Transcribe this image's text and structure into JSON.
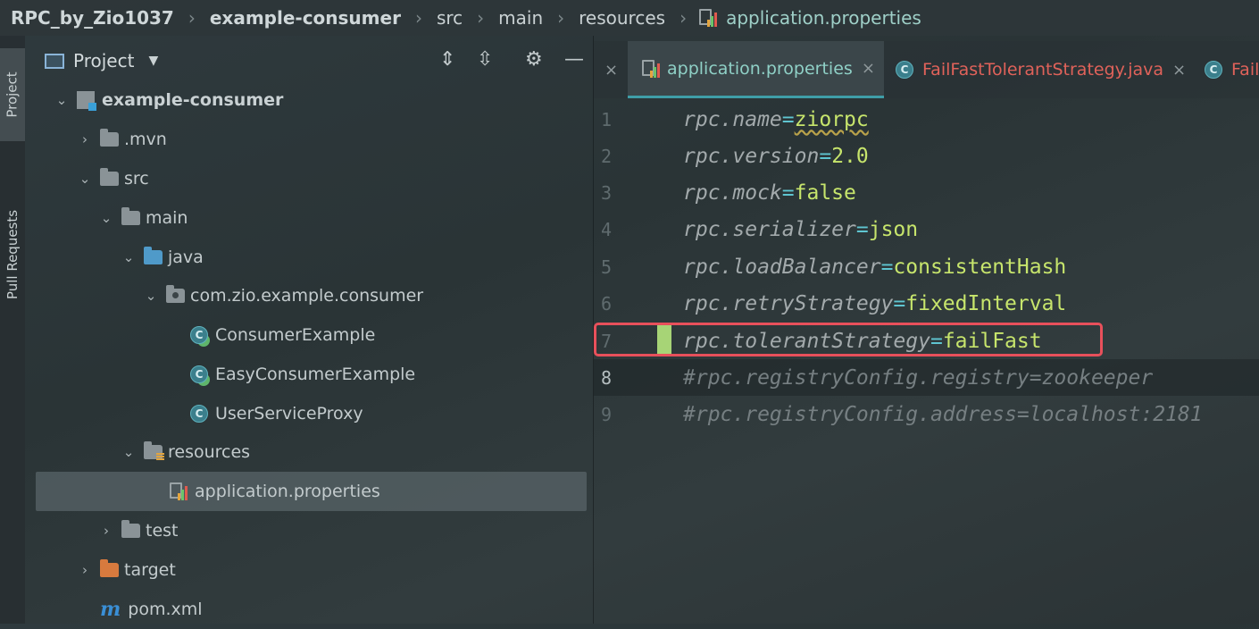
{
  "breadcrumb": {
    "items": [
      "RPC_by_Zio1037",
      "example-consumer",
      "src",
      "main",
      "resources",
      "application.properties"
    ]
  },
  "toolstrip": {
    "project_label": "Project",
    "pull_requests_label": "Pull Requests"
  },
  "project_panel": {
    "title": "Project",
    "tree": [
      {
        "label": "example-consumer",
        "icon": "module-icon"
      },
      {
        "label": ".mvn",
        "icon": "folder-icon"
      },
      {
        "label": "src",
        "icon": "folder-icon"
      },
      {
        "label": "main",
        "icon": "folder-icon"
      },
      {
        "label": "java",
        "icon": "source-folder-icon"
      },
      {
        "label": "com.zio.example.consumer",
        "icon": "package-icon"
      },
      {
        "label": "ConsumerExample",
        "icon": "java-class-icon"
      },
      {
        "label": "EasyConsumerExample",
        "icon": "java-class-icon"
      },
      {
        "label": "UserServiceProxy",
        "icon": "java-class-icon"
      },
      {
        "label": "resources",
        "icon": "resources-folder-icon"
      },
      {
        "label": "application.properties",
        "icon": "properties-file-icon"
      },
      {
        "label": "test",
        "icon": "folder-icon"
      },
      {
        "label": "target",
        "icon": "excluded-folder-icon"
      },
      {
        "label": "pom.xml",
        "icon": "maven-icon"
      }
    ]
  },
  "editor": {
    "tabs": [
      {
        "label": "application.properties"
      },
      {
        "label": "FailFastTolerantStrategy.java"
      },
      {
        "label": "Fail"
      }
    ],
    "line_numbers": [
      "1",
      "2",
      "3",
      "4",
      "5",
      "6",
      "7",
      "8",
      "9"
    ],
    "lines": [
      {
        "key": "rpc.name",
        "eq": "=",
        "value": "ziorpc"
      },
      {
        "key": "rpc.version",
        "eq": "=",
        "value": "2.0"
      },
      {
        "key": "rpc.mock",
        "eq": "=",
        "value": "false"
      },
      {
        "key": "rpc.serializer",
        "eq": "=",
        "value": "json"
      },
      {
        "key": "rpc.loadBalancer",
        "eq": "=",
        "value": "consistentHash"
      },
      {
        "key": "rpc.retryStrategy",
        "eq": "=",
        "value": "fixedInterval"
      },
      {
        "key": "rpc.tolerantStrategy",
        "eq": "=",
        "value": "failFast"
      },
      {
        "comment": "#rpc.registryConfig.registry=zookeeper"
      },
      {
        "comment": "#rpc.registryConfig.address=localhost:2181"
      }
    ],
    "current_line": "8",
    "highlighted_line": "7"
  },
  "colors": {
    "accent": "#3f9ea8",
    "highlight_border": "#e8505b",
    "change_marker": "#a7d476",
    "value": "#c7e56c",
    "equals": "#5fc5d1",
    "modified_tab": "#e0625a"
  }
}
